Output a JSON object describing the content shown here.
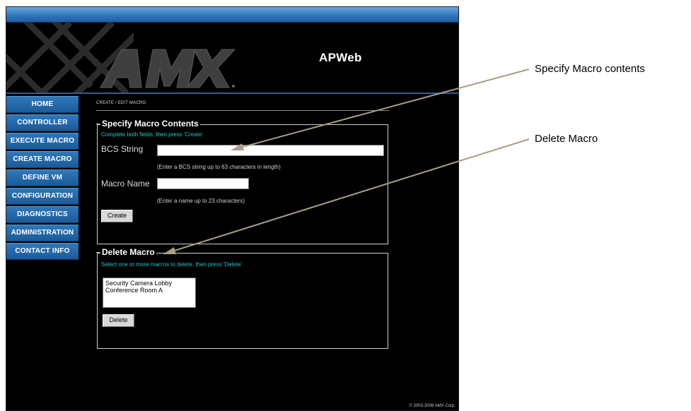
{
  "app": {
    "title": "APWeb",
    "logo_text": "AMX",
    "copyright": "© 2003-2008 AMX Corp."
  },
  "nav": {
    "items": [
      {
        "label": "HOME"
      },
      {
        "label": "CONTROLLER"
      },
      {
        "label": "EXECUTE MACRO"
      },
      {
        "label": "CREATE MACRO"
      },
      {
        "label": "DEFINE VM"
      },
      {
        "label": "CONFIGURATION"
      },
      {
        "label": "DIAGNOSTICS"
      },
      {
        "label": "ADMINISTRATION"
      },
      {
        "label": "CONTACT INFO"
      }
    ]
  },
  "breadcrumb": "CREATE / EDIT MACRO",
  "specify": {
    "legend": "Specify Macro Contents",
    "instruction": "Complete both fields, then press 'Create'",
    "bcs_label": "BCS String",
    "bcs_value": "",
    "bcs_hint": "(Enter a BCS string up to 63 characters in length)",
    "name_label": "Macro Name",
    "name_value": "",
    "name_hint": "(Enter a name up to 23 characters)",
    "create_button": "Create"
  },
  "delete": {
    "legend": "Delete Macro",
    "instruction": "Select one or more macros to delete, then press 'Delete'",
    "macros": [
      "Security Camera Lobby",
      "Conference Room A"
    ],
    "delete_button": "Delete"
  },
  "callouts": {
    "specify": "Specify Macro contents",
    "delete": "Delete Macro"
  },
  "colors": {
    "nav_blue": "#1b5a98",
    "accent_cyan": "#1fc6c6",
    "callout_line": "#a89f86"
  }
}
